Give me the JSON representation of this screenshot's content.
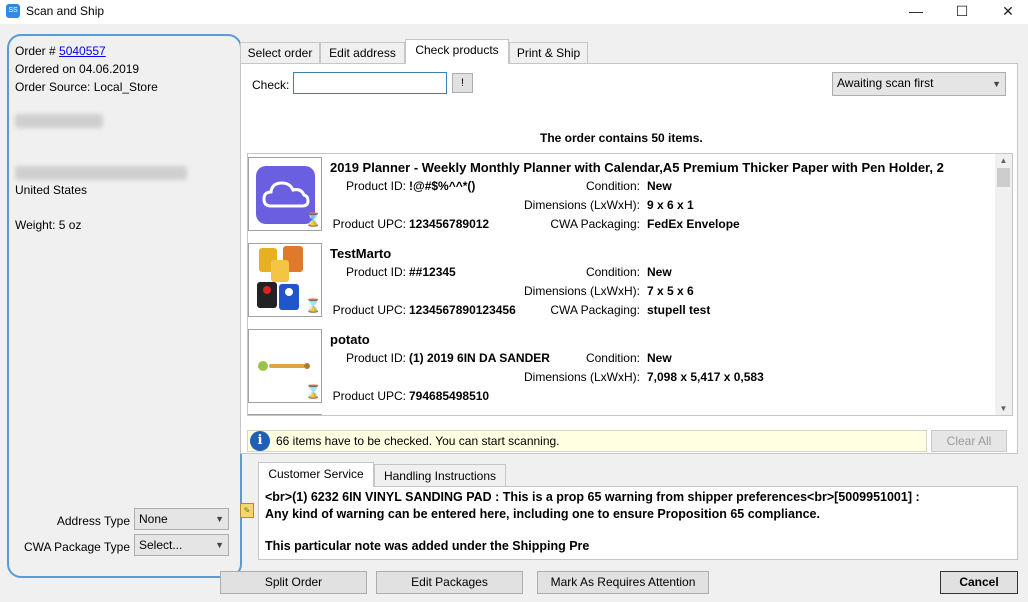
{
  "window": {
    "title": "Scan and Ship",
    "app_icon_text": "SS",
    "minimize": "—",
    "maximize": "☐",
    "close": "✕"
  },
  "order": {
    "number_label": "Order # ",
    "number": "5040557",
    "ordered_on": "Ordered on 04.06.2019",
    "source": "Order Source: Local_Store",
    "country": "United States",
    "weight": "Weight: 5 oz"
  },
  "address_type": {
    "label": "Address Type",
    "value": "None"
  },
  "cwa_package_type": {
    "label": "CWA Package Type",
    "value": "Select..."
  },
  "tabs": [
    {
      "label": "Select order"
    },
    {
      "label": "Edit address"
    },
    {
      "label": "Check products"
    },
    {
      "label": "Print & Ship"
    }
  ],
  "check": {
    "label": "Check:",
    "value": "",
    "button_label": "!",
    "status_value": "Awaiting scan first"
  },
  "order_count": "The order contains 50 items.",
  "labels": {
    "product_id": "Product ID:",
    "condition": "Condition:",
    "dimensions": "Dimensions (LxWxH):",
    "product_upc": "Product UPC:",
    "cwa_packaging": "CWA Packaging:"
  },
  "products": [
    {
      "title": "2019 Planner - Weekly  Monthly Planner with Calendar,A5 Premium Thicker Paper with Pen Holder, 2",
      "product_id": "!@#$%^^*()",
      "condition": "New",
      "dimensions": "9 x 6 x 1",
      "upc": "123456789012",
      "packaging": "FedEx Envelope"
    },
    {
      "title": "TestMarto",
      "product_id": "##12345",
      "condition": "New",
      "dimensions": "7 x 5 x 6",
      "upc": "1234567890123456",
      "packaging": "stupell test"
    },
    {
      "title": "potato",
      "product_id": "(1) 2019 6IN DA SANDER",
      "condition": "New",
      "dimensions": "7,098 x 5,417 x 0,583",
      "upc": "794685498510",
      "packaging": ""
    }
  ],
  "info_message": "66 items have to be checked. You can start scanning.",
  "clear_all": "Clear All",
  "bottom_tabs": [
    {
      "label": "Customer Service"
    },
    {
      "label": "Handling Instructions"
    }
  ],
  "notes": {
    "line1": "<br>(1) 6232 6IN VINYL SANDING PAD : This is a prop 65 warning from shipper preferences<br>[5009951001] :",
    "line2": "Any kind of warning can be entered here, including one to ensure Proposition 65 compliance.",
    "line3": "This particular note was added under the Shipping Pre"
  },
  "buttons": {
    "split_order": "Split Order",
    "edit_packages": "Edit Packages",
    "mark_attention": "Mark As Requires Attention",
    "cancel": "Cancel"
  },
  "colors": {
    "accent": "#5b9bd5",
    "link": "#0000ee",
    "info_bg": "#ffffe1",
    "info_icon": "#1f5fb5"
  }
}
